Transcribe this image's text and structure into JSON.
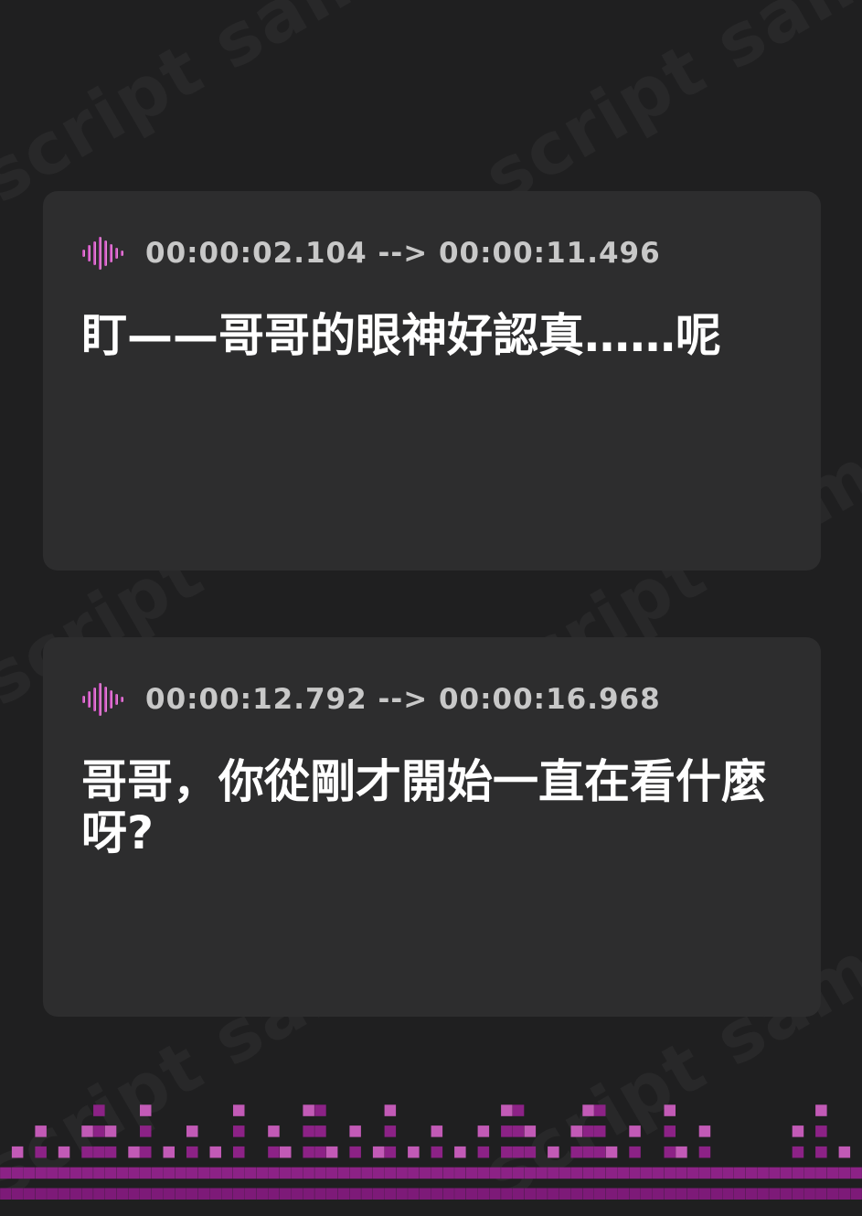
{
  "watermark": {
    "text": "script sample"
  },
  "colors": {
    "background": "#1f1f20",
    "card": "#2d2d2e",
    "accent_light": "#e88ad6",
    "accent_dark": "#7a1a74",
    "text": "#ffffff",
    "timestamp": "#c8c8c8"
  },
  "cues": [
    {
      "icon": "audio-wave-icon",
      "timestamp": "00:00:02.104 --> 00:00:11.496",
      "text": "盯——哥哥的眼神好認真……呢"
    },
    {
      "icon": "audio-wave-icon",
      "timestamp": "00:00:12.792 --> 00:00:16.968",
      "text": "哥哥，你從剛才開始一直在看什麼呀?"
    }
  ],
  "equalizer": {
    "icon": "equalizer-decoration",
    "levels": [
      2,
      3,
      2,
      4,
      2,
      3,
      2,
      4,
      6,
      4,
      2,
      3,
      5,
      2,
      3,
      2,
      4,
      2,
      3,
      2,
      5,
      2,
      2,
      4,
      3,
      2,
      5,
      7,
      3,
      2,
      4,
      2,
      3,
      5,
      2,
      3,
      2,
      4,
      2,
      3,
      2,
      4,
      2,
      5,
      7,
      4,
      2,
      3,
      2,
      4,
      5,
      6,
      3,
      2,
      4,
      2,
      2,
      5,
      3,
      2,
      4,
      2,
      2,
      2,
      2,
      2,
      2,
      2,
      4,
      2,
      5,
      2,
      3,
      2
    ]
  }
}
